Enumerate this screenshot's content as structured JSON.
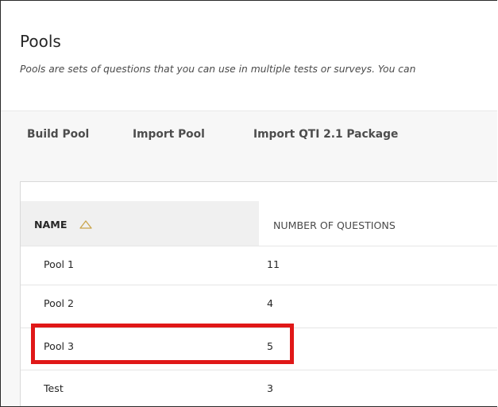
{
  "page": {
    "title": "Pools",
    "description": "Pools are sets of questions that you can use in multiple tests or surveys. You can"
  },
  "actions": {
    "build_pool": "Build Pool",
    "import_pool": "Import Pool",
    "import_qti": "Import QTI 2.1 Package"
  },
  "table": {
    "columns": {
      "name": "NAME",
      "questions": "NUMBER OF QUESTIONS"
    },
    "sort": {
      "column": "name",
      "direction": "ascending",
      "icon": "sort-ascending-icon"
    },
    "rows": [
      {
        "name": "Pool 1",
        "questions": "11"
      },
      {
        "name": "Pool 2",
        "questions": "4"
      },
      {
        "name": "Pool 3",
        "questions": "5"
      },
      {
        "name": "Test",
        "questions": "3"
      }
    ]
  },
  "highlight": {
    "row": "Pool 3",
    "color": "#e01818"
  }
}
